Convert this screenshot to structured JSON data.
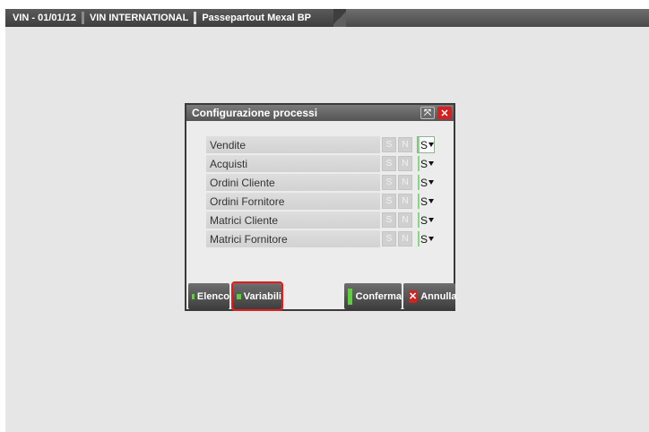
{
  "tabbar": {
    "segment1": "VIN - 01/01/12",
    "segment2": "VIN INTERNATIONAL",
    "segment3": "Passepartout Mexal BP"
  },
  "dialog": {
    "title": "Configurazione processi",
    "resize_glyph": "⤧",
    "close_glyph": "✕",
    "rows": [
      {
        "label": "Vendite",
        "s": "S",
        "n": "N",
        "value": "S"
      },
      {
        "label": "Acquisti",
        "s": "S",
        "n": "N",
        "value": "S"
      },
      {
        "label": "Ordini Cliente",
        "s": "S",
        "n": "N",
        "value": "S"
      },
      {
        "label": "Ordini Fornitore",
        "s": "S",
        "n": "N",
        "value": "S"
      },
      {
        "label": "Matrici Cliente",
        "s": "S",
        "n": "N",
        "value": "S"
      },
      {
        "label": "Matrici Fornitore",
        "s": "S",
        "n": "N",
        "value": "S"
      }
    ],
    "buttons": {
      "elenco": "Elenco",
      "variabili": "Variabili",
      "conferma": "Conferma",
      "annulla": "Annulla",
      "annulla_icon": "✕"
    }
  },
  "colors": {
    "accent_green": "#5ecf3a",
    "close_red": "#d62020",
    "highlight_red": "#e11d1d"
  }
}
